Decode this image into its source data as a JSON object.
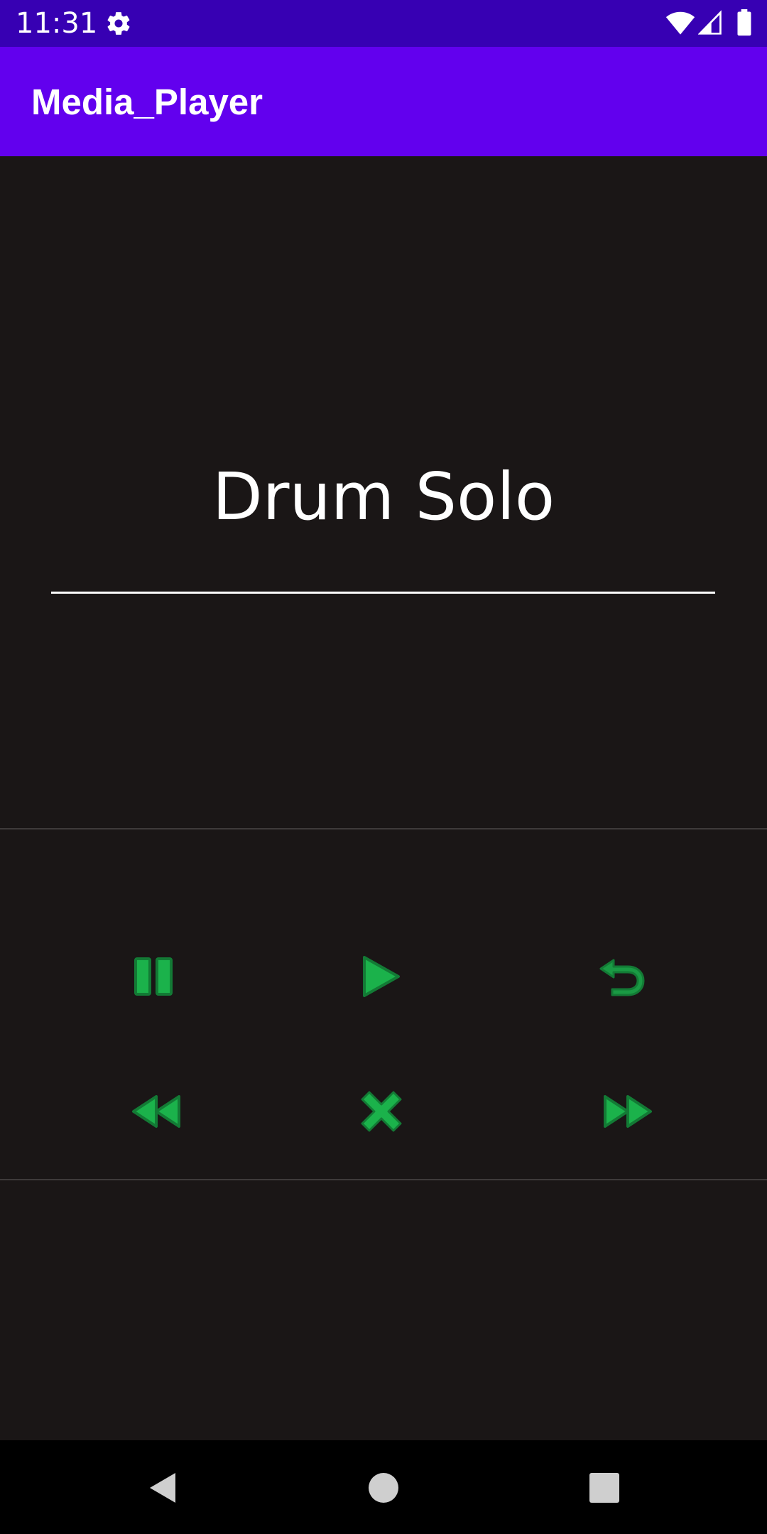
{
  "status_bar": {
    "time": "11:31",
    "icons": [
      "gear-icon",
      "wifi-icon",
      "cellular-signal-icon",
      "battery-icon"
    ]
  },
  "app_bar": {
    "title": "Media_Player",
    "color": "#6200ee",
    "status_color": "#3700b3"
  },
  "player": {
    "song_title": "Drum Solo",
    "accent_color": "#1bb24b",
    "controls_row_1": [
      "pause-icon",
      "play-icon",
      "replay-icon"
    ],
    "controls_row_2": [
      "rewind-icon",
      "stop-icon",
      "fast-forward-icon"
    ]
  },
  "nav_bar": {
    "buttons": [
      "back-icon",
      "home-icon",
      "recents-icon"
    ]
  }
}
